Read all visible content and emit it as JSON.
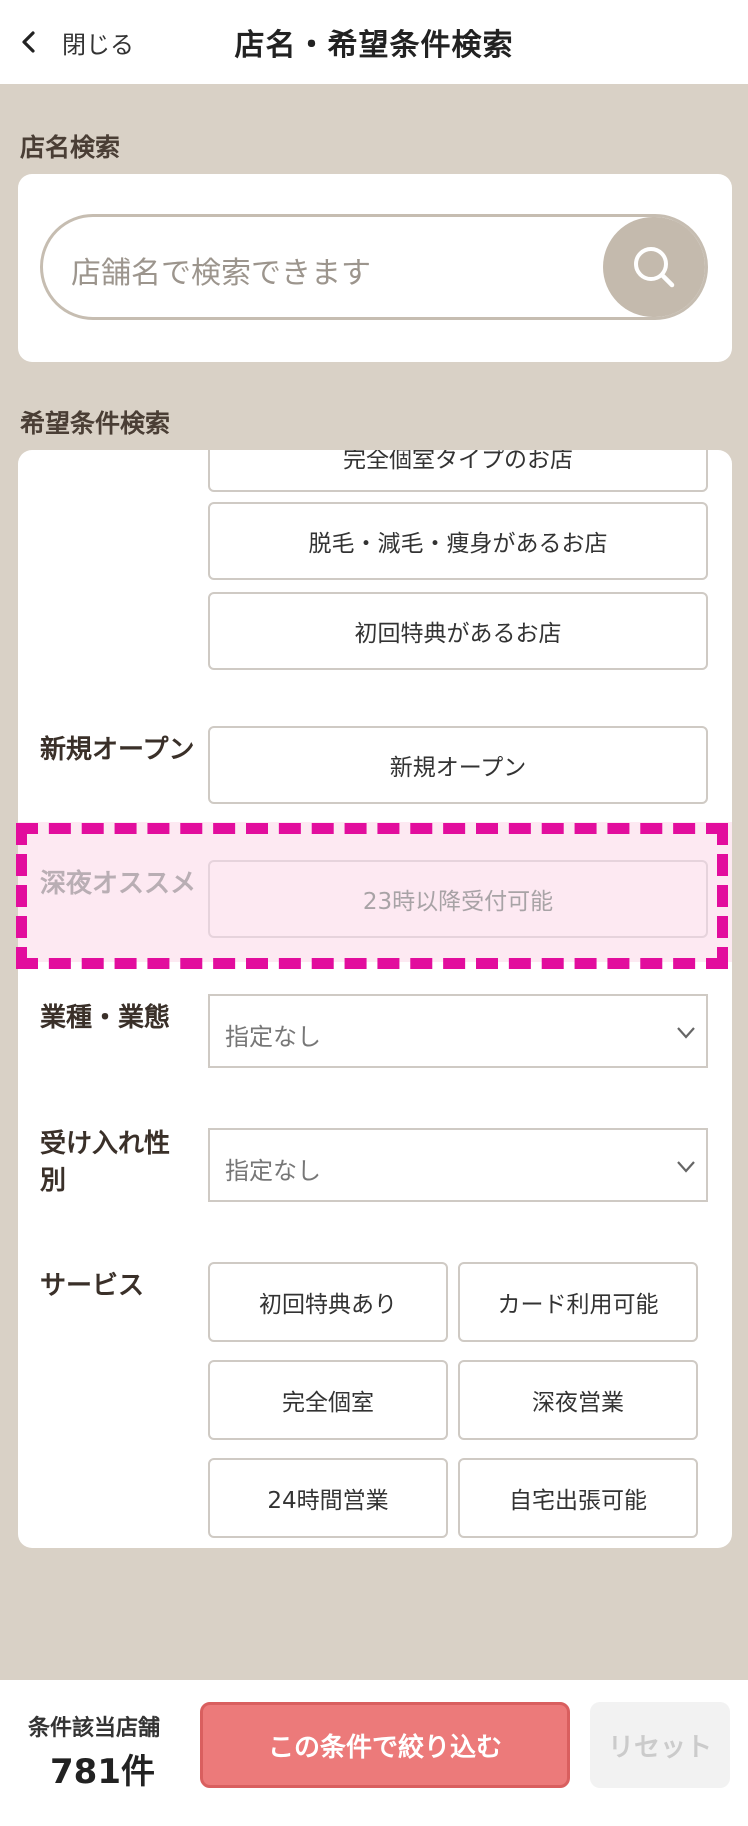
{
  "header": {
    "back_label": "閉じる",
    "title": "店名・希望条件検索"
  },
  "name_search": {
    "section_label": "店名検索",
    "placeholder": "店舗名で検索できます"
  },
  "conditions": {
    "section_label": "希望条件検索",
    "top_options": [
      "完全個室タイプのお店",
      "脱毛・減毛・痩身があるお店",
      "初回特典があるお店"
    ],
    "new_open": {
      "label": "新規オープン",
      "option": "新規オープン"
    },
    "late_night": {
      "label": "深夜オススメ",
      "option": "23時以降受付可能"
    },
    "business_type": {
      "label": "業種・業態",
      "value": "指定なし"
    },
    "gender": {
      "label": "受け入れ性別",
      "value": "指定なし"
    },
    "services": {
      "label": "サービス",
      "options": [
        "初回特典あり",
        "カード利用可能",
        "完全個室",
        "深夜営業",
        "24時間営業",
        "自宅出張可能"
      ]
    }
  },
  "footer": {
    "count_label": "条件該当店舗",
    "count_value": "781件",
    "apply_label": "この条件で絞り込む",
    "reset_label": "リセット"
  },
  "colors": {
    "background": "#d9d1c6",
    "apply": "#ec7a7a",
    "highlight_border": "#e20d9d",
    "highlight_fill": "#fde9f2"
  },
  "icons": {
    "back": "chevron-left-icon",
    "search": "search-icon",
    "select": "chevron-down-icon"
  }
}
